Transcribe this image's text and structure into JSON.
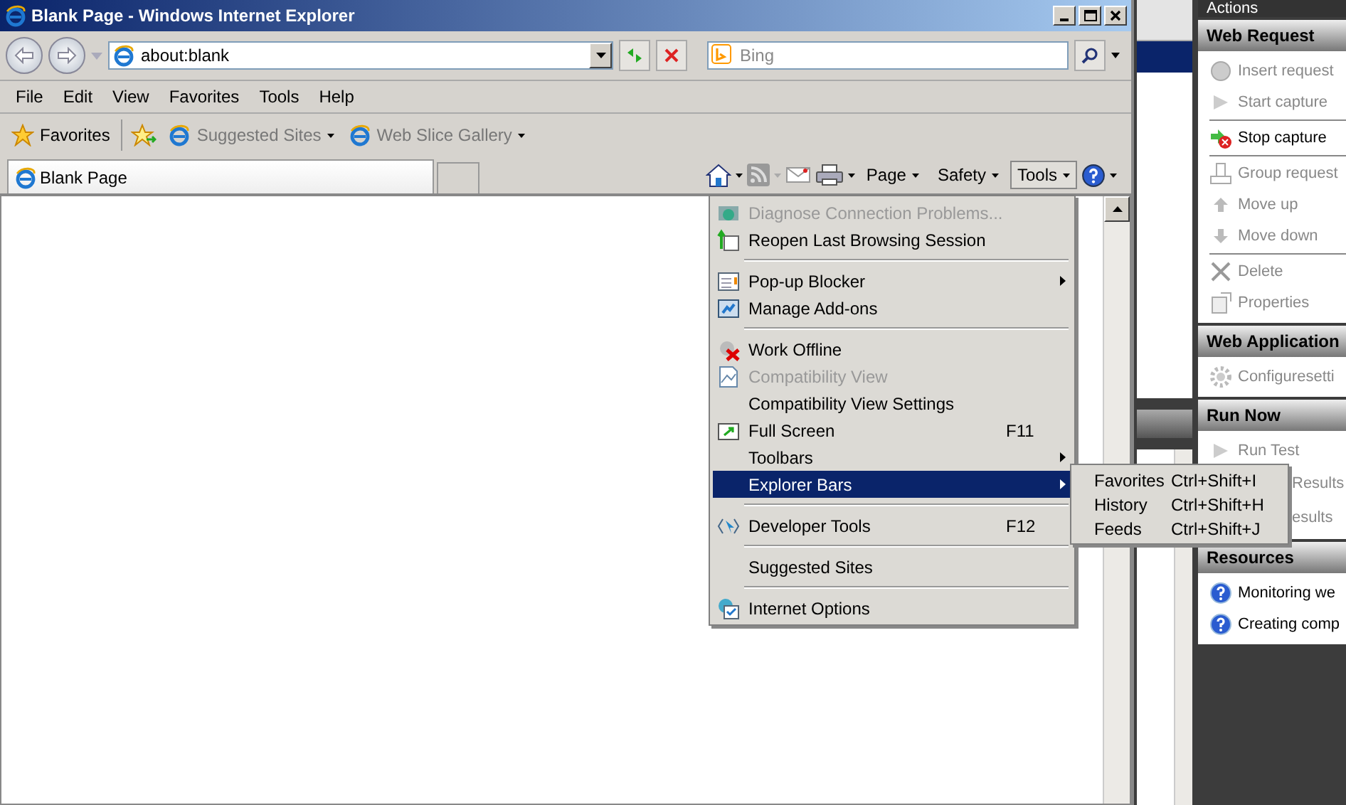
{
  "window": {
    "title": "Blank Page - Windows Internet Explorer"
  },
  "address_bar": {
    "value": "about:blank"
  },
  "search": {
    "placeholder": "Bing"
  },
  "menu_bar": [
    "File",
    "Edit",
    "View",
    "Favorites",
    "Tools",
    "Help"
  ],
  "favorites_bar": {
    "label": "Favorites",
    "links": [
      {
        "label": "Suggested Sites"
      },
      {
        "label": "Web Slice Gallery"
      }
    ]
  },
  "tabs": [
    {
      "label": "Blank Page",
      "selected": true
    }
  ],
  "command_bar": [
    {
      "label": "Page",
      "pressed": false
    },
    {
      "label": "Safety",
      "pressed": false
    },
    {
      "label": "Tools",
      "pressed": true
    }
  ],
  "tools_menu": [
    {
      "kind": "item",
      "label": "Diagnose Connection Problems...",
      "disabled": true,
      "selected": false
    },
    {
      "kind": "item",
      "label": "Reopen Last Browsing Session",
      "disabled": false,
      "selected": false
    },
    {
      "kind": "separator"
    },
    {
      "kind": "item",
      "label": "Pop-up Blocker",
      "disabled": false,
      "selected": false,
      "submenu": true
    },
    {
      "kind": "item",
      "label": "Manage Add-ons",
      "disabled": false,
      "selected": false
    },
    {
      "kind": "separator"
    },
    {
      "kind": "item",
      "label": "Work Offline",
      "disabled": false,
      "selected": false
    },
    {
      "kind": "item",
      "label": "Compatibility View",
      "disabled": true,
      "selected": false
    },
    {
      "kind": "item",
      "label": "Compatibility View Settings",
      "disabled": false,
      "selected": false
    },
    {
      "kind": "item",
      "label": "Full Screen",
      "shortcut": "F11",
      "disabled": false,
      "selected": false
    },
    {
      "kind": "item",
      "label": "Toolbars",
      "disabled": false,
      "selected": false,
      "submenu": true
    },
    {
      "kind": "item",
      "label": "Explorer Bars",
      "disabled": false,
      "selected": true,
      "submenu": true
    },
    {
      "kind": "separator"
    },
    {
      "kind": "item",
      "label": "Developer Tools",
      "shortcut": "F12",
      "disabled": false,
      "selected": false
    },
    {
      "kind": "separator"
    },
    {
      "kind": "item",
      "label": "Suggested Sites",
      "disabled": false,
      "selected": false
    },
    {
      "kind": "separator"
    },
    {
      "kind": "item",
      "label": "Internet Options",
      "disabled": false,
      "selected": false
    }
  ],
  "explorer_bars_submenu": [
    {
      "label": "Favorites",
      "shortcut": "Ctrl+Shift+I"
    },
    {
      "label": "History",
      "shortcut": "Ctrl+Shift+H"
    },
    {
      "label": "Feeds",
      "shortcut": "Ctrl+Shift+J"
    }
  ],
  "actions_pane": {
    "title": "Actions",
    "sections": [
      {
        "title": "Web Request",
        "items": [
          {
            "kind": "item",
            "label": "Insert request",
            "disabled": true
          },
          {
            "kind": "item",
            "label": "Start capture",
            "disabled": true
          },
          {
            "kind": "separator"
          },
          {
            "kind": "item",
            "label": "Stop capture",
            "disabled": false
          },
          {
            "kind": "separator"
          },
          {
            "kind": "item",
            "label": "Group request",
            "disabled": true
          },
          {
            "kind": "item",
            "label": "Move up",
            "disabled": true
          },
          {
            "kind": "item",
            "label": "Move down",
            "disabled": true
          },
          {
            "kind": "separator"
          },
          {
            "kind": "item",
            "label": "Delete",
            "disabled": true
          },
          {
            "kind": "item",
            "label": "Properties",
            "disabled": true
          }
        ]
      },
      {
        "title": "Web Application",
        "items": [
          {
            "kind": "item",
            "label": "Configuresetti",
            "disabled": true
          }
        ]
      },
      {
        "title": "Run Now",
        "items": [
          {
            "kind": "item",
            "label": "Run Test",
            "disabled": true
          },
          {
            "kind": "covered",
            "label": "Results",
            "disabled": true
          },
          {
            "kind": "covered",
            "label": "esults",
            "disabled": true
          }
        ]
      },
      {
        "title": "Resources",
        "items": [
          {
            "kind": "item",
            "label": "Monitoring we",
            "disabled": false
          },
          {
            "kind": "item",
            "label": "Creating comp",
            "disabled": false
          }
        ]
      }
    ]
  }
}
